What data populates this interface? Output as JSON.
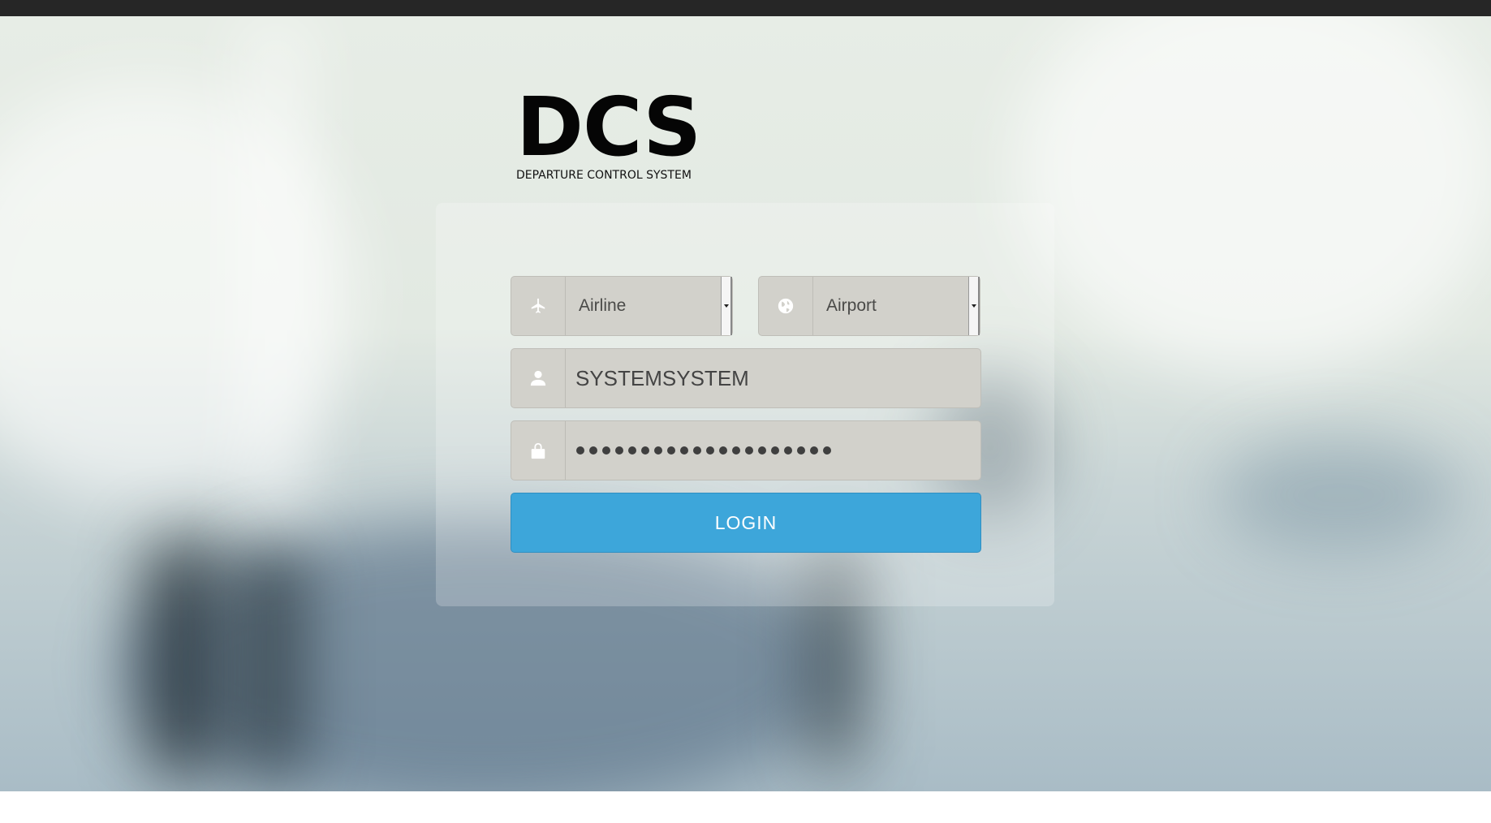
{
  "logo": {
    "mark": "DCS",
    "subtitle": "DEPARTURE CONTROL SYSTEM"
  },
  "form": {
    "airline": {
      "icon": "airplane-icon",
      "selected": "Airline"
    },
    "airport": {
      "icon": "globe-icon",
      "selected": "Airport"
    },
    "username": {
      "icon": "user-icon",
      "value": "SYSTEMSYSTEM"
    },
    "password": {
      "icon": "lock-icon",
      "masked_length": 20
    },
    "login_label": "LOGIN"
  },
  "colors": {
    "accent": "#3da6da",
    "field_bg": "#d2d1cb",
    "topbar": "#262626"
  }
}
